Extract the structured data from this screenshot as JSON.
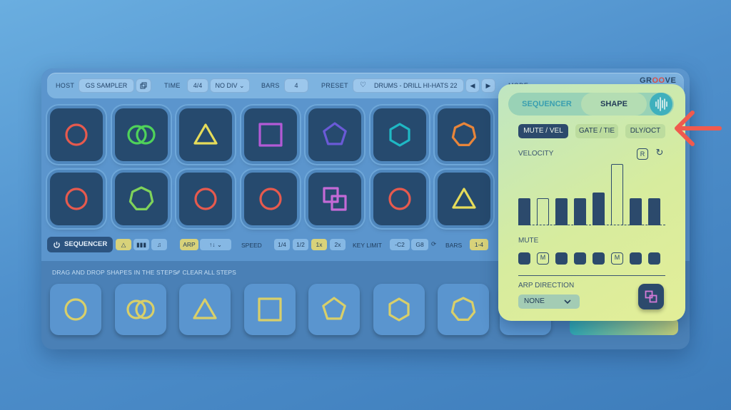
{
  "header": {
    "host_label": "HOST",
    "host_value": "GS SAMPLER",
    "time_label": "TIME",
    "time_sig": "4/4",
    "time_div": "NO DIV",
    "bars_label": "BARS",
    "bars_value": "4",
    "preset_label": "PRESET",
    "preset_name": "DRUMS - DRILL HI-HATS 22",
    "mode_label": "MODE",
    "logo_a": "GR",
    "logo_b": "OO",
    "logo_c": "VE"
  },
  "pads_row1": [
    {
      "shape": "circle",
      "color": "#e65a4e"
    },
    {
      "shape": "double-circle",
      "color": "#4fd35a"
    },
    {
      "shape": "triangle",
      "color": "#e6dc5a"
    },
    {
      "shape": "square",
      "color": "#b35ad6"
    },
    {
      "shape": "pentagon",
      "color": "#6a5ad6"
    },
    {
      "shape": "hexagon",
      "color": "#1fb8c4"
    },
    {
      "shape": "heptagon",
      "color": "#e8853a"
    }
  ],
  "pads_row2": [
    {
      "shape": "circle",
      "color": "#e65a4e"
    },
    {
      "shape": "heptagon",
      "color": "#7fd35a"
    },
    {
      "shape": "circle",
      "color": "#e65a4e"
    },
    {
      "shape": "circle",
      "color": "#e65a4e"
    },
    {
      "shape": "linked-squares",
      "color": "#c46ad6"
    },
    {
      "shape": "circle",
      "color": "#e65a4e"
    },
    {
      "shape": "triangle",
      "color": "#e6dc5a"
    }
  ],
  "seqbar": {
    "sequencer_label": "SEQUENCER",
    "arp_label": "ARP",
    "arp_dir": "↑↓",
    "speed_label": "SPEED",
    "speeds": [
      "1/4",
      "1/2",
      "1x",
      "2x"
    ],
    "speed_selected": "1x",
    "keylimit_label": "KEY LIMIT",
    "key_low": "-C2",
    "key_high": "G8",
    "bars_label": "BARS",
    "bars_value": "1-4"
  },
  "tray": {
    "hint": "DRAG AND DROP SHAPES IN THE STEPS",
    "clear_label": "CLEAR ALL STEPS",
    "shapes": [
      "circle",
      "double-circle",
      "triangle",
      "square",
      "pentagon",
      "hexagon",
      "heptagon"
    ],
    "color": "#d8cf6a"
  },
  "panel": {
    "tab_sequencer": "SEQUENCER",
    "tab_shape": "SHAPE",
    "mode_buttons": [
      "MUTE / VEL",
      "GATE / TIE",
      "DLY/OCT"
    ],
    "velocity_label": "VELOCITY",
    "reset_glyph": "R",
    "velocity": [
      0.44,
      0.44,
      0.44,
      0.44,
      0.54,
      1.0,
      0.44,
      0.44
    ],
    "velocity_hollow": [
      false,
      true,
      false,
      false,
      false,
      true,
      false,
      false
    ],
    "mute_label": "MUTE",
    "mutes": [
      "",
      "M",
      "",
      "",
      "",
      "M",
      "",
      ""
    ],
    "arp_direction_label": "ARP DIRECTION",
    "arp_direction_value": "NONE"
  },
  "colors": {
    "annotation_arrow": "#f05a4e",
    "panel_dark": "#2c4a6c"
  }
}
